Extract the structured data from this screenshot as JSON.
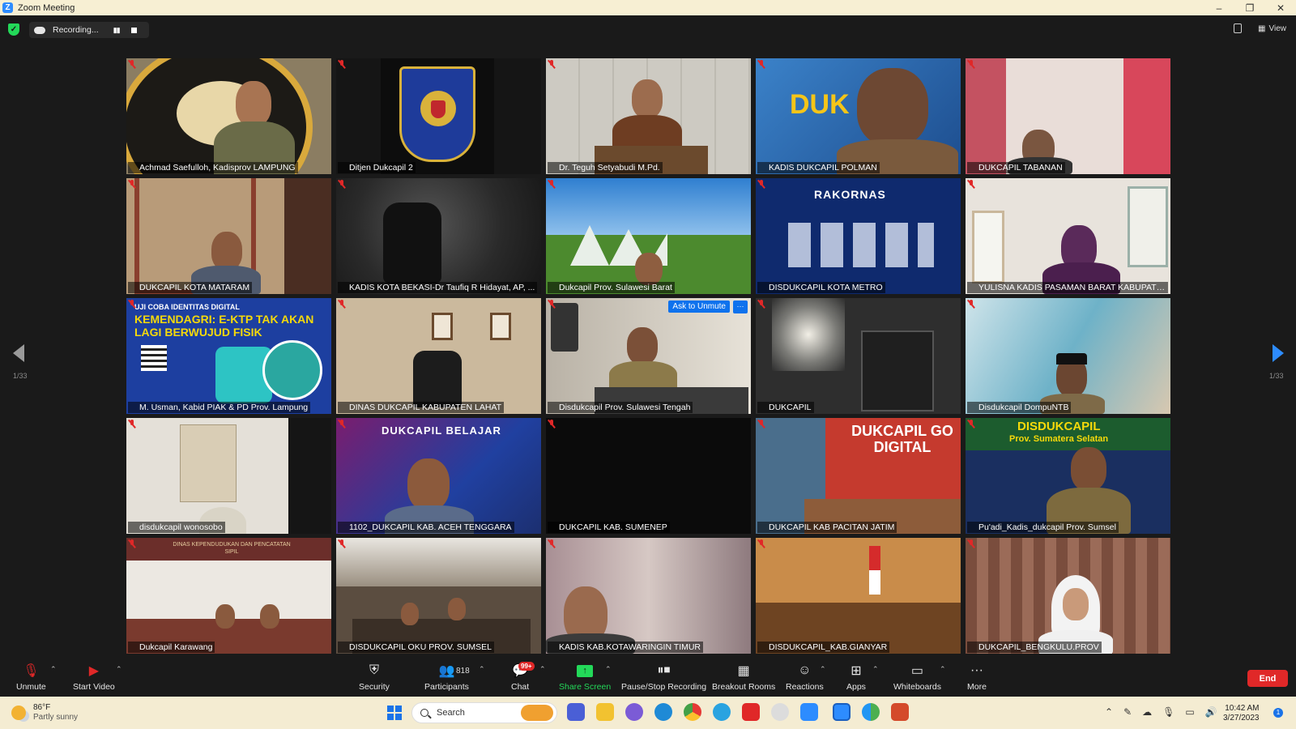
{
  "window": {
    "title": "Zoom Meeting",
    "minimize": "–",
    "maximize": "❐",
    "close": "✕"
  },
  "topbar": {
    "recording_label": "Recording...",
    "pause": "▮▮",
    "view_label": "View"
  },
  "pagination": {
    "left": "1/33",
    "right": "1/33"
  },
  "participants": [
    {
      "name": "Achmad Saefulloh, Kadisprov LAMPUNG"
    },
    {
      "name": "Ditjen Dukcapil 2"
    },
    {
      "name": "Dr. Teguh Setyabudi M.Pd.",
      "active": true
    },
    {
      "name": "KADIS DUKCAPIL POLMAN"
    },
    {
      "name": "DUKCAPIL TABANAN"
    },
    {
      "name": "DUKCAPIL KOTA MATARAM"
    },
    {
      "name": "KADIS KOTA BEKASI-Dr Taufiq R Hidayat, AP, ..."
    },
    {
      "name": "Dukcapil Prov. Sulawesi Barat"
    },
    {
      "name": "DISDUKCAPIL KOTA METRO"
    },
    {
      "name": "YULISNA KADIS PASAMAN BARAT KABUPATEN"
    },
    {
      "name": "M. Usman, Kabid PIAK & PD Prov. Lampung"
    },
    {
      "name": "DINAS DUKCAPIL KABUPATEN LAHAT"
    },
    {
      "name": "Disdukcapil Prov. Sulawesi Tengah"
    },
    {
      "name": "DUKCAPIL"
    },
    {
      "name": "Disdukcapil DompuNTB"
    },
    {
      "name": "disdukcapil wonosobo"
    },
    {
      "name": "1102_DUKCAPIL KAB. ACEH TENGGARA"
    },
    {
      "name": "DUKCAPIL KAB. SUMENEP"
    },
    {
      "name": "DUKCAPIL KAB PACITAN JATIM"
    },
    {
      "name": "Pu'adi_Kadis_dukcapil Prov. Sumsel"
    },
    {
      "name": "Dukcapil Karawang"
    },
    {
      "name": "DISDUKCAPIL OKU PROV. SUMSEL"
    },
    {
      "name": "KADIS KAB.KOTAWARINGIN TIMUR"
    },
    {
      "name": "DISDUKCAPIL_KAB.GIANYAR"
    },
    {
      "name": "DUKCAPIL_BENGKULU.PROV"
    }
  ],
  "tile_texts": {
    "ask_to_unmute": "Ask to Unmute",
    "more": "···",
    "rakornas": "RAKORNAS",
    "dukcapil_belajar": "DUKCAPIL BELAJAR",
    "ktp_line1": "UJI COBA IDENTITAS DIGITAL",
    "ktp_line2": "KEMENDAGRI: E-KTP TAK AKAN LAGI BERWUJUD FISIK",
    "go_digital": "DUKCAPIL GO DIGITAL",
    "disdukcapil_sumsel": "DISDUKCAPIL",
    "sumsel_sub": "Prov. Sumatera Selatan",
    "polman_text": "DUK",
    "dinas_banner": "DINAS KEPENDUDUKAN DAN PENCATATAN SIPIL"
  },
  "toolbar": {
    "unmute": "Unmute",
    "start_video": "Start Video",
    "security": "Security",
    "participants": "Participants",
    "participants_count": "818",
    "chat": "Chat",
    "chat_badge": "99+",
    "share_screen": "Share Screen",
    "pause_stop_recording": "Pause/Stop Recording",
    "breakout_rooms": "Breakout Rooms",
    "reactions": "Reactions",
    "apps": "Apps",
    "whiteboards": "Whiteboards",
    "more": "More",
    "end": "End"
  },
  "taskbar": {
    "weather_temp": "86°F",
    "weather_desc": "Partly sunny",
    "search_placeholder": "Search",
    "time": "10:42 AM",
    "date": "3/27/2023",
    "notification_count": "1"
  },
  "colors": {
    "accent": "#2d8cff",
    "end": "#e02828",
    "share": "#23d959",
    "active_border": "#d8e22a"
  }
}
